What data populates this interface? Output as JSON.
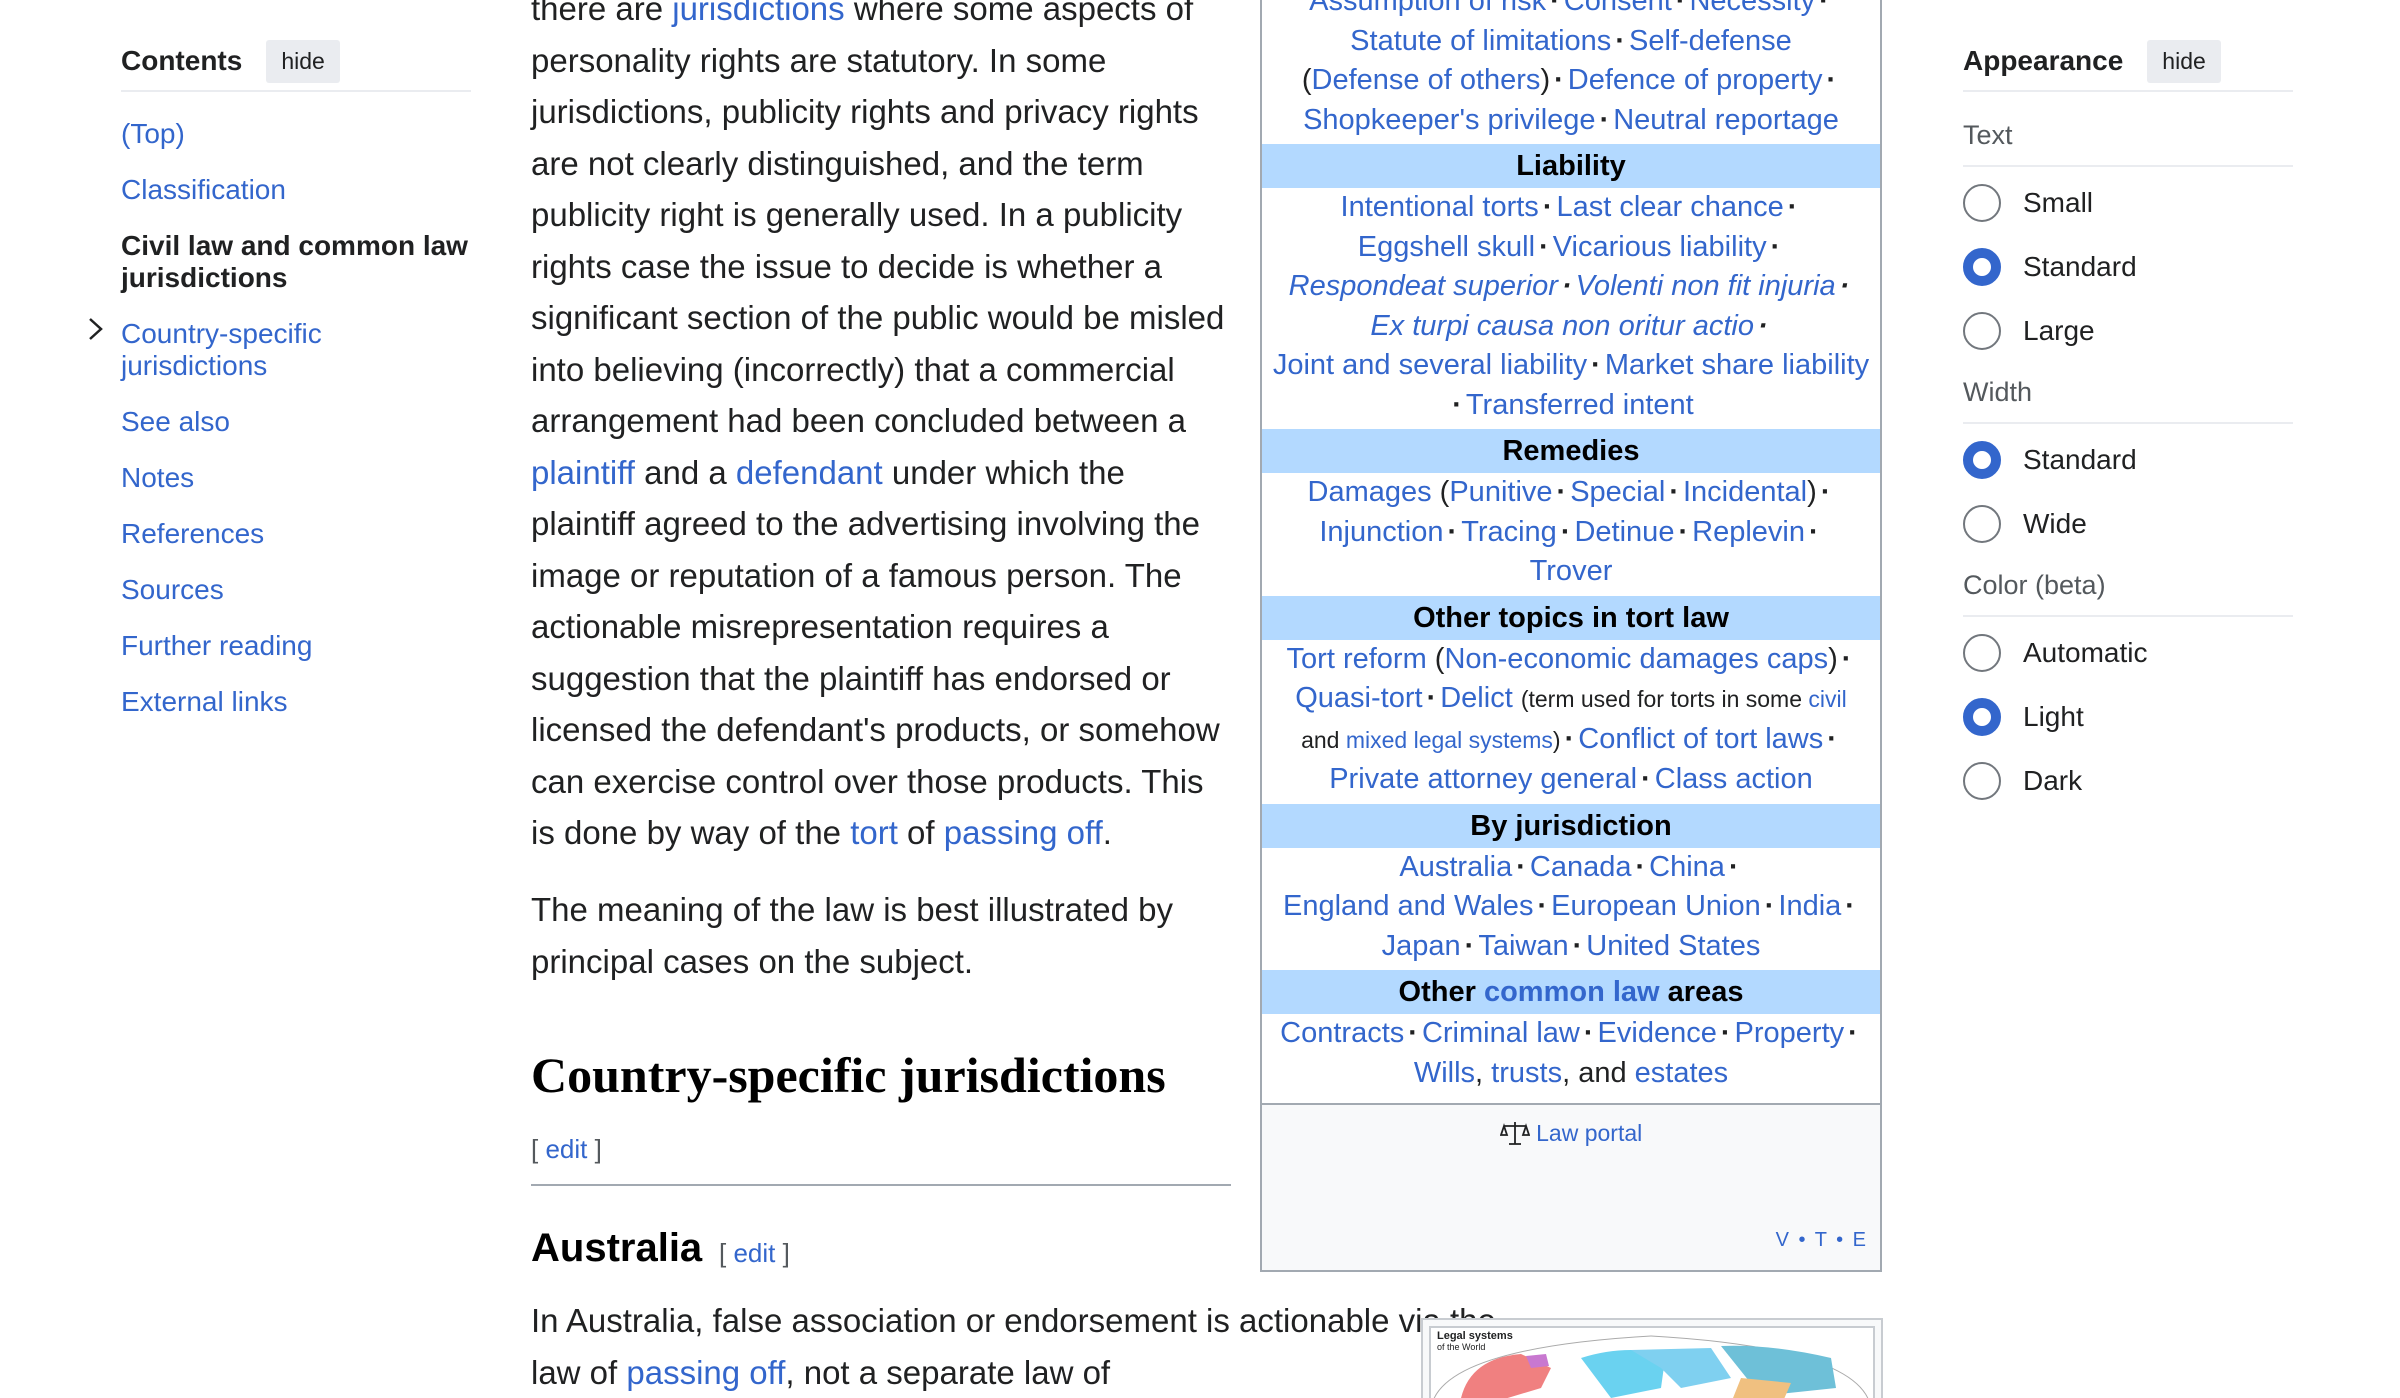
{
  "toc": {
    "title": "Contents",
    "hide_label": "hide",
    "items": [
      {
        "label": "(Top)"
      },
      {
        "label": "Classification"
      },
      {
        "label": "Civil law and common law jurisdictions"
      },
      {
        "label": "Country-specific jurisdictions"
      },
      {
        "label": "See also"
      },
      {
        "label": "Notes"
      },
      {
        "label": "References"
      },
      {
        "label": "Sources"
      },
      {
        "label": "Further reading"
      },
      {
        "label": "External links"
      }
    ]
  },
  "article": {
    "p1": {
      "t1": "there are ",
      "l1": "jurisdictions",
      "t2": " where some aspects of personality rights are statutory. In some jurisdictions, publicity rights and privacy rights are not clearly distinguished, and the term publicity right is generally used. In a publicity rights case the issue to decide is whether a significant section of the public would be misled into believing (incorrectly) that a commercial arrangement had been concluded between a ",
      "l2": "plaintiff",
      "t3": " and a ",
      "l3": "defendant",
      "t4": " under which the plaintiff agreed to the advertising involving the image or reputation of a famous person. The actionable misrepresentation requires a suggestion that the plaintiff has endorsed or licensed the defendant's products, or somehow can exercise control over those products. This is done by way of the ",
      "l4": "tort",
      "t5": " of ",
      "l5": "passing off",
      "t6": "."
    },
    "p2": "The meaning of the law is best illustrated by principal cases on the subject.",
    "h2": "Country-specific jurisdictions",
    "h3": "Australia",
    "edit": "edit",
    "p3": {
      "t1": "In Australia, false association or endorsement is actionable via the law of ",
      "l1": "passing off",
      "t2": ", not a separate law of"
    }
  },
  "navbox": {
    "top_rows": [
      [
        "Assumption of risk",
        "Consent",
        "Necessity"
      ],
      [
        "Statute of limitations",
        "Self-defense"
      ]
    ],
    "top_line3": {
      "open": "(",
      "a": "Defense of others",
      "close": ")",
      "b": "Defence of property"
    },
    "top_line4": [
      "Shopkeeper's privilege",
      "Neutral reportage"
    ],
    "liability": {
      "title": "Liability",
      "lines": [
        [
          "Intentional torts",
          "Last clear chance"
        ],
        [
          "Eggshell skull",
          "Vicarious liability"
        ],
        [
          "Respondeat superior",
          "Volenti non fit injuria"
        ],
        [
          "Ex turpi causa non oritur actio"
        ],
        [
          "Joint and several liability",
          "Market share liability"
        ],
        [
          "Transferred intent"
        ]
      ]
    },
    "remedies": {
      "title": "Remedies",
      "damages": "Damages",
      "sub": [
        "Punitive",
        "Special",
        "Incidental"
      ],
      "lines": [
        [
          "Injunction",
          "Tracing",
          "Detinue",
          "Replevin"
        ],
        [
          "Trover"
        ]
      ]
    },
    "other": {
      "title": "Other topics in tort law",
      "tort_reform": "Tort reform",
      "ned_caps": "Non-economic damages caps",
      "quasi": "Quasi-tort",
      "delict": "Delict",
      "note1": "(term used for torts in some ",
      "civil": "civil",
      "and": "and ",
      "mixed": "mixed legal systems",
      "note_close": ")",
      "conflict": "Conflict of tort laws",
      "pag": "Private attorney general",
      "class": "Class action"
    },
    "jurisdiction": {
      "title": "By jurisdiction",
      "lines": [
        [
          "Australia",
          "Canada",
          "China"
        ],
        [
          "England and Wales",
          "European Union",
          "India"
        ],
        [
          "Japan",
          "Taiwan",
          "United States"
        ]
      ]
    },
    "areas": {
      "title_a": "Other ",
      "title_link": "common law",
      "title_b": " areas",
      "line1": [
        "Contracts",
        "Criminal law",
        "Evidence",
        "Property"
      ],
      "wills": "Wills",
      "trusts": "trusts",
      "and": ", and ",
      "estates": "estates"
    },
    "portal": "Law portal",
    "vte": "V • T • E"
  },
  "map": {
    "title": "Legal systems",
    "subtitle": "of the World"
  },
  "appearance": {
    "title": "Appearance",
    "hide_label": "hide",
    "groups": [
      {
        "label": "Text",
        "options": [
          {
            "label": "Small",
            "checked": false
          },
          {
            "label": "Standard",
            "checked": true
          },
          {
            "label": "Large",
            "checked": false
          }
        ]
      },
      {
        "label": "Width",
        "options": [
          {
            "label": "Standard",
            "checked": true
          },
          {
            "label": "Wide",
            "checked": false
          }
        ]
      },
      {
        "label": "Color (beta)",
        "options": [
          {
            "label": "Automatic",
            "checked": false
          },
          {
            "label": "Light",
            "checked": true
          },
          {
            "label": "Dark",
            "checked": false
          }
        ]
      }
    ]
  },
  "colors": {
    "link": "#3366cc",
    "navbox_header": "#b3d9ff",
    "radio_checked": "#3366cc"
  }
}
